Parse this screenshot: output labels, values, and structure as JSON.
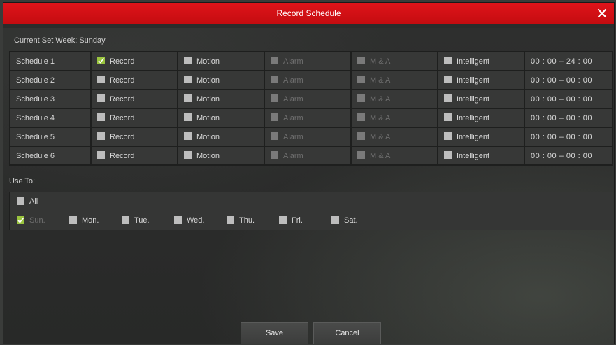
{
  "title": "Record Schedule",
  "current_week_label": "Current Set Week: Sunday",
  "schedules": [
    {
      "name": "Schedule 1",
      "record": "Record",
      "record_checked": true,
      "motion": "Motion",
      "alarm": "Alarm",
      "ma": "M & A",
      "intelligent": "Intelligent",
      "time": "00 : 00 – 24 : 00"
    },
    {
      "name": "Schedule 2",
      "record": "Record",
      "record_checked": false,
      "motion": "Motion",
      "alarm": "Alarm",
      "ma": "M & A",
      "intelligent": "Intelligent",
      "time": "00 : 00 – 00 : 00"
    },
    {
      "name": "Schedule 3",
      "record": "Record",
      "record_checked": false,
      "motion": "Motion",
      "alarm": "Alarm",
      "ma": "M & A",
      "intelligent": "Intelligent",
      "time": "00 : 00 – 00 : 00"
    },
    {
      "name": "Schedule 4",
      "record": "Record",
      "record_checked": false,
      "motion": "Motion",
      "alarm": "Alarm",
      "ma": "M & A",
      "intelligent": "Intelligent",
      "time": "00 : 00 – 00 : 00"
    },
    {
      "name": "Schedule 5",
      "record": "Record",
      "record_checked": false,
      "motion": "Motion",
      "alarm": "Alarm",
      "ma": "M & A",
      "intelligent": "Intelligent",
      "time": "00 : 00 – 00 : 00"
    },
    {
      "name": "Schedule 6",
      "record": "Record",
      "record_checked": false,
      "motion": "Motion",
      "alarm": "Alarm",
      "ma": "M & A",
      "intelligent": "Intelligent",
      "time": "00 : 00 – 00 : 00"
    }
  ],
  "use_to_label": "Use To:",
  "all_label": "All",
  "days": [
    {
      "label": "Sun.",
      "checked": true,
      "disabled": true
    },
    {
      "label": "Mon.",
      "checked": false
    },
    {
      "label": "Tue.",
      "checked": false
    },
    {
      "label": "Wed.",
      "checked": false
    },
    {
      "label": "Thu.",
      "checked": false
    },
    {
      "label": "Fri.",
      "checked": false
    },
    {
      "label": "Sat.",
      "checked": false
    }
  ],
  "save_label": "Save",
  "cancel_label": "Cancel",
  "colors": {
    "titlebar": "#d8121a",
    "checked": "#9ac43f"
  }
}
